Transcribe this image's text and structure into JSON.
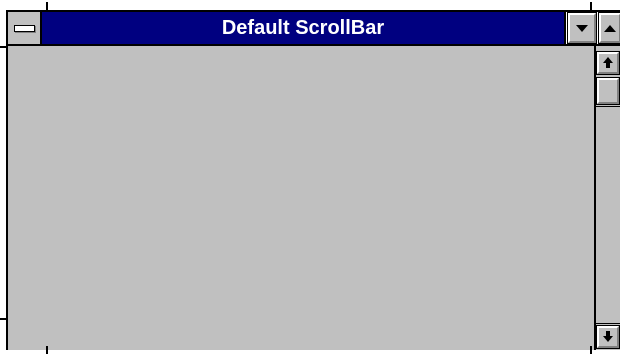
{
  "window": {
    "title": "Default ScrollBar"
  },
  "icons": {
    "system_menu": "system-menu-icon",
    "minimize": "minimize-icon",
    "maximize": "maximize-icon",
    "scroll_up": "arrow-up-icon",
    "scroll_down": "arrow-down-icon"
  },
  "colors": {
    "title_bar": "#000080",
    "title_text": "#ffffff",
    "face": "#c0c0c0"
  }
}
